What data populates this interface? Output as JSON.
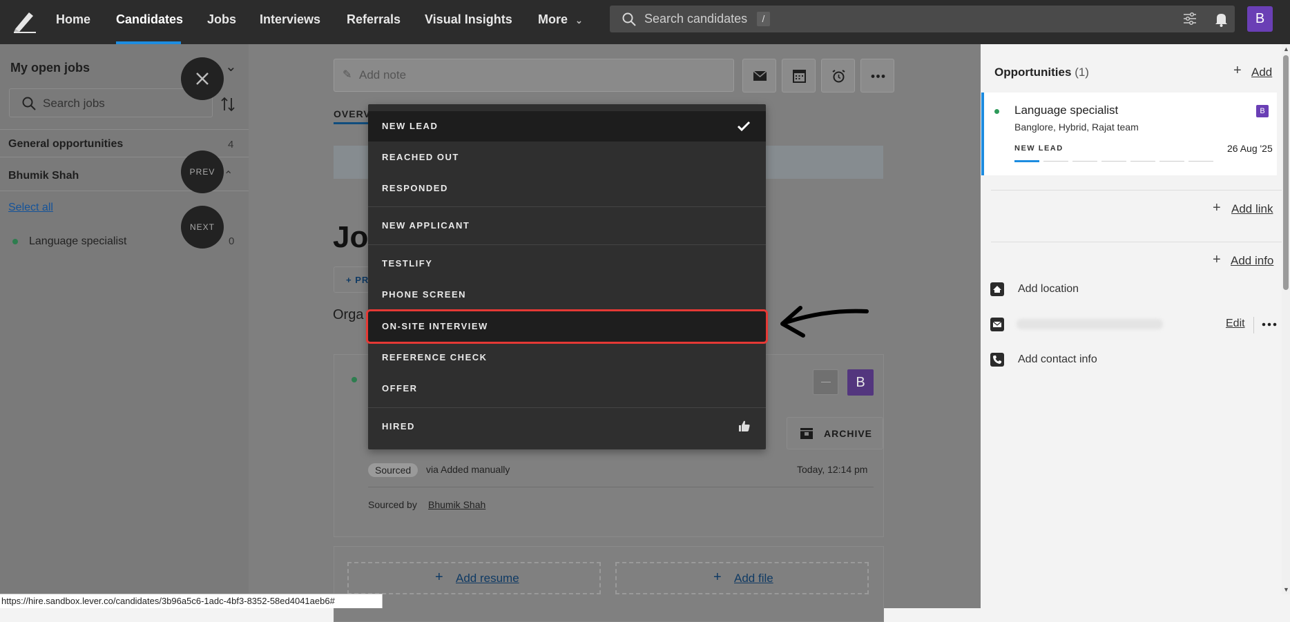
{
  "topnav": {
    "home": "Home",
    "candidates": "Candidates",
    "jobs": "Jobs",
    "interviews": "Interviews",
    "referrals": "Referrals",
    "visual_insights": "Visual Insights",
    "more": "More",
    "search_placeholder": "Search candidates",
    "search_shortcut": "/",
    "avatar_letter": "B",
    "accent_color": "#1d8ce0"
  },
  "left_panel": {
    "title": "My open jobs",
    "search_placeholder": "Search jobs",
    "general_opportunities": {
      "label": "General opportunities",
      "count": "4"
    },
    "owner": "Bhumik Shah",
    "select_all": "Select all",
    "jobs": [
      {
        "label": "Language specialist",
        "count": "0"
      }
    ],
    "close_label": "",
    "prev_label": "PREV",
    "next_label": "NEXT"
  },
  "main": {
    "add_note_placeholder": "Add note",
    "tab_overview": "OVERV",
    "heading_partial": "Job",
    "profile_btn_partial": "+ PR",
    "org_partial": "Orga",
    "card": {
      "avatar_letter": "B",
      "archive_label": "ARCHIVE",
      "source_badge": "Sourced",
      "source_via": "via Added manually",
      "time": "Today, 12:14 pm",
      "sourced_by_label": "Sourced by",
      "sourced_by_name": "Bhumik Shah"
    },
    "add_resume": "Add resume",
    "add_file": "Add file"
  },
  "stage_dropdown": {
    "items": [
      {
        "label": "NEW LEAD",
        "selected": true
      },
      {
        "label": "REACHED OUT"
      },
      {
        "label": "RESPONDED"
      },
      {
        "label": "NEW APPLICANT"
      },
      {
        "label": "TESTLIFY"
      },
      {
        "label": "PHONE SCREEN"
      },
      {
        "label": "ON-SITE INTERVIEW",
        "highlighted": true
      },
      {
        "label": "REFERENCE CHECK"
      },
      {
        "label": "OFFER"
      },
      {
        "label": "HIRED"
      }
    ],
    "highlight_color": "#e53935"
  },
  "right_panel": {
    "opportunities_title": "Opportunities",
    "opportunities_count": "(1)",
    "add": "Add",
    "opportunity": {
      "title": "Language specialist",
      "subtitle": "Banglore, Hybrid, Rajat team",
      "stage": "NEW LEAD",
      "date": "26 Aug '25",
      "badge": "B",
      "progress_steps": 7,
      "progress_current": 1
    },
    "add_link": "Add link",
    "add_info": "Add info",
    "add_location": "Add location",
    "edit": "Edit",
    "add_contact_info": "Add contact info"
  },
  "status_url": "https://hire.sandbox.lever.co/candidates/3b96a5c6-1adc-4bf3-8352-58ed4041aeb6#"
}
